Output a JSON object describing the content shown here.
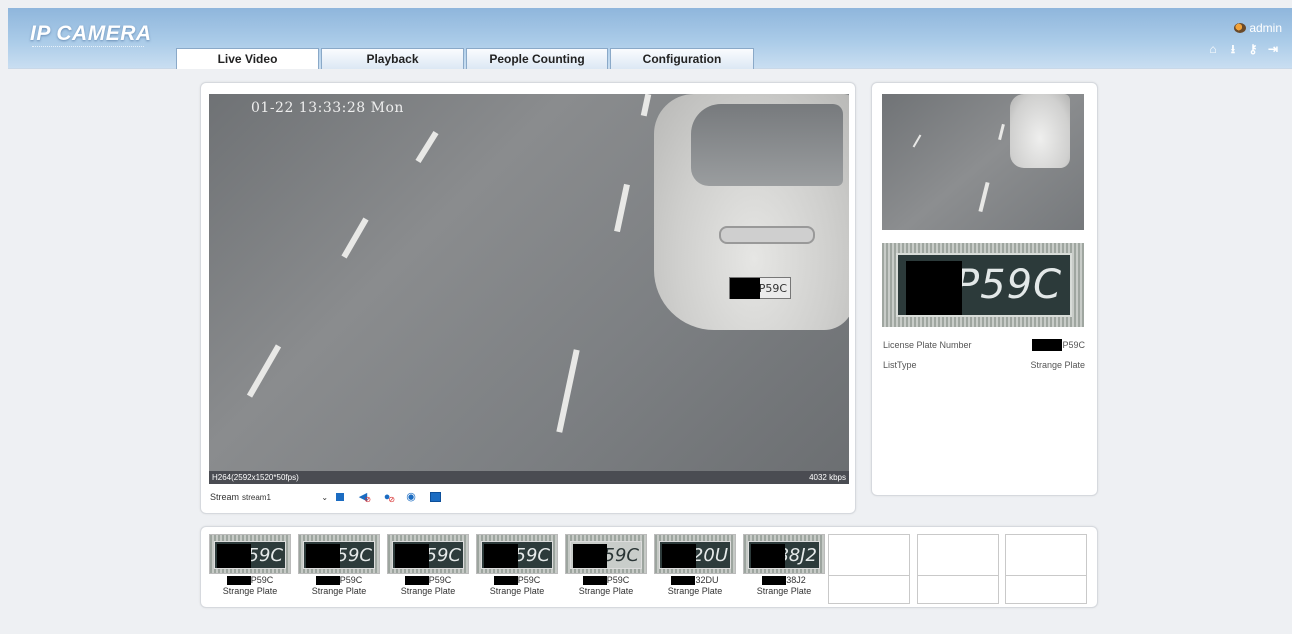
{
  "header": {
    "logo": "IP CAMERA",
    "user": "admin",
    "tools": [
      {
        "name": "home-icon",
        "glyph": "⌂"
      },
      {
        "name": "download-icon",
        "glyph": "⭳"
      },
      {
        "name": "key-icon",
        "glyph": "⚷"
      },
      {
        "name": "logout-icon",
        "glyph": "⇥"
      }
    ]
  },
  "tabs": [
    {
      "label": "Live Video",
      "active": true
    },
    {
      "label": "Playback",
      "active": false
    },
    {
      "label": "People Counting",
      "active": false
    },
    {
      "label": "Configuration",
      "active": false
    }
  ],
  "video": {
    "osd_time": "01-22 13:33:28 Mon",
    "plate_visible": "P59C",
    "codec_info": "H264(2592x1520*50fps)",
    "bitrate": "4032 kbps"
  },
  "controls": {
    "stream_label": "Stream",
    "stream_value": "stream1",
    "buttons": [
      "stop-icon",
      "mute-icon",
      "talk-icon",
      "snapshot-icon",
      "fullscreen-icon"
    ]
  },
  "capture": {
    "plate_image_text": "0P59C",
    "license_plate_label": "License Plate Number",
    "license_plate_value": "P59C",
    "list_type_label": "ListType",
    "list_type_value": "Strange Plate"
  },
  "thumbnails": [
    {
      "plate_img": "P59C",
      "number": "P59C",
      "type": "Strange Plate"
    },
    {
      "plate_img": "P59C",
      "number": "P59C",
      "type": "Strange Plate"
    },
    {
      "plate_img": "P59C",
      "number": "P59C",
      "type": "Strange Plate"
    },
    {
      "plate_img": "P59C",
      "number": "P59C",
      "type": "Strange Plate"
    },
    {
      "plate_img": "0P59C",
      "number": "P59C",
      "type": "Strange Plate"
    },
    {
      "plate_img": "9320U",
      "number": "32DU",
      "type": "Strange Plate"
    },
    {
      "plate_img": "288J2",
      "number": "38J2",
      "type": "Strange Plate"
    }
  ],
  "colors": {
    "accent_blue": "#1b6cc2",
    "header_top": "#8fb6dc"
  }
}
